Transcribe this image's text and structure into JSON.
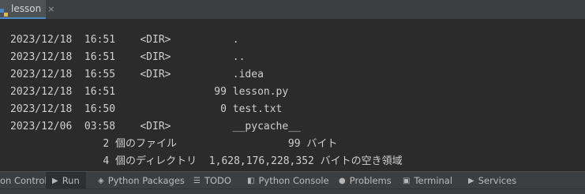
{
  "editor_tab": {
    "label": "lesson",
    "close_glyph": "×"
  },
  "console_lines": [
    "2023/12/18  16:51    <DIR>          .",
    "2023/12/18  16:51    <DIR>          ..",
    "2023/12/18  16:55    <DIR>          .idea",
    "2023/12/18  16:51                99 lesson.py",
    "2023/12/18  16:50                 0 test.txt",
    "2023/12/06  03:58    <DIR>          __pycache__",
    "               2 個のファイル                  99 バイト",
    "               4 個のディレクトリ  1,628,176,228,352 バイトの空き領域"
  ],
  "tool_windows": [
    {
      "label": "on Control",
      "icon": "version-control-icon"
    },
    {
      "label": "Run",
      "icon": "run-icon",
      "active": true
    },
    {
      "label": "Python Packages",
      "icon": "packages-icon"
    },
    {
      "label": "TODO",
      "icon": "todo-icon"
    },
    {
      "label": "Python Console",
      "icon": "python-console-icon"
    },
    {
      "label": "Problems",
      "icon": "problems-icon"
    },
    {
      "label": "Terminal",
      "icon": "terminal-icon"
    },
    {
      "label": "Services",
      "icon": "services-icon"
    }
  ],
  "colors": {
    "console_bg": "#2b2b2b",
    "console_text": "#d0d0d0",
    "toolbar_bg": "#3c3f41",
    "tab_accent": "#4a88c7"
  }
}
